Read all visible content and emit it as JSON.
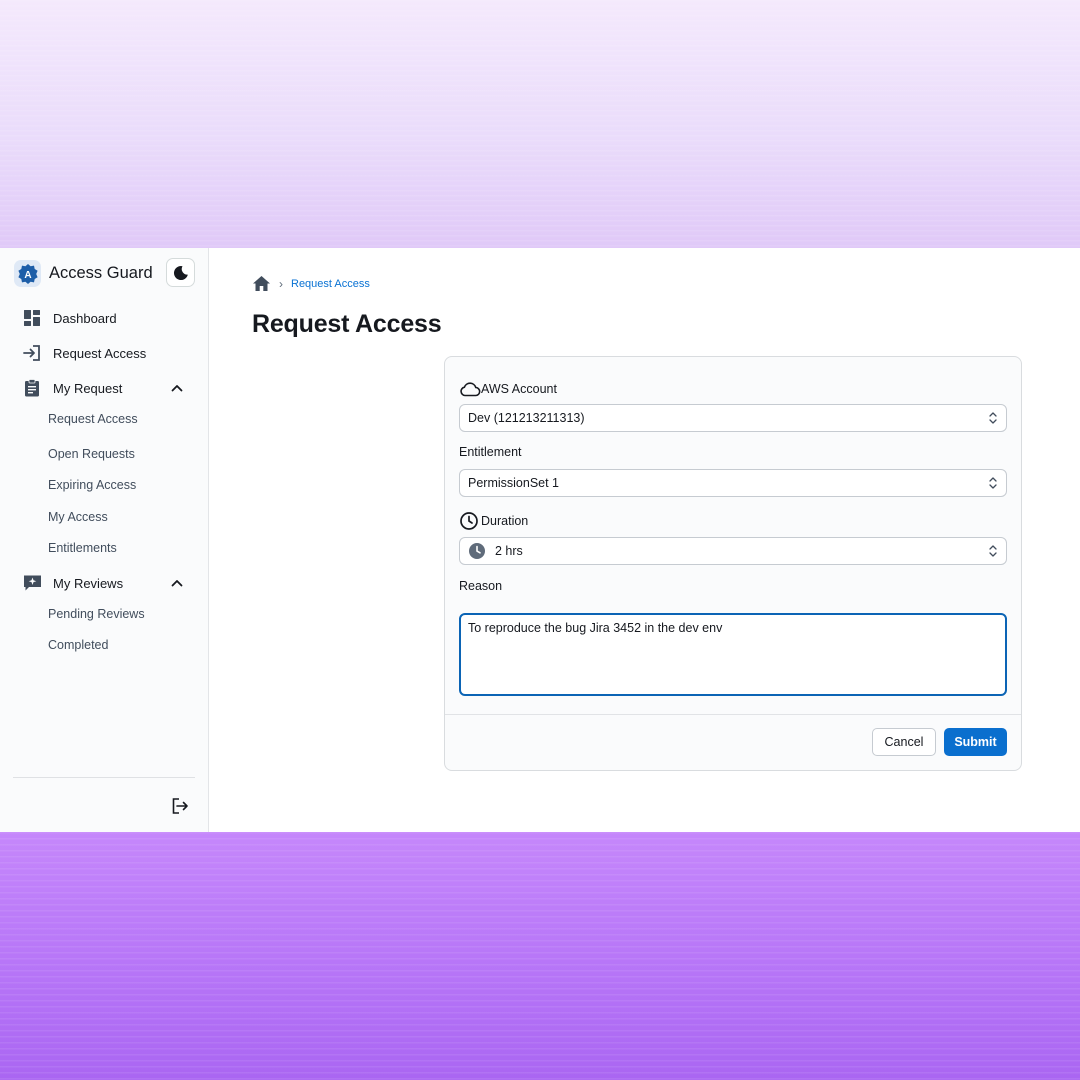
{
  "app": {
    "name": "Access Guard",
    "logo_letter": "A"
  },
  "sidebar": {
    "items": [
      {
        "label": "Dashboard",
        "icon": "dashboard-icon"
      },
      {
        "label": "Request Access",
        "icon": "login-arrow-icon"
      },
      {
        "label": "My Request",
        "icon": "clipboard-icon",
        "expanded": true,
        "children": [
          "Request Access",
          "Open Requests",
          "Expiring Access",
          "My Access",
          "Entitlements"
        ]
      },
      {
        "label": "My Reviews",
        "icon": "review-star-icon",
        "expanded": true,
        "children": [
          "Pending Reviews",
          "Completed"
        ]
      }
    ],
    "logout_icon": "logout-icon",
    "theme_icon": "moon-icon"
  },
  "breadcrumb": {
    "home_icon": "home-icon",
    "current": "Request Access"
  },
  "page": {
    "title": "Request Access"
  },
  "form": {
    "aws_account": {
      "label": "AWS Account",
      "icon": "cloud-icon",
      "value": "Dev (121213211313)"
    },
    "entitlement": {
      "label": "Entitlement",
      "value": "PermissionSet 1"
    },
    "duration": {
      "label": "Duration",
      "icon": "clock-icon",
      "value": "2 hrs"
    },
    "reason": {
      "label": "Reason",
      "value": "To reproduce the bug Jira 3452 in the dev env"
    },
    "cancel_label": "Cancel",
    "submit_label": "Submit"
  },
  "colors": {
    "accent": "#0a6fce",
    "link": "#0972d3",
    "focus": "#0b64b5"
  }
}
